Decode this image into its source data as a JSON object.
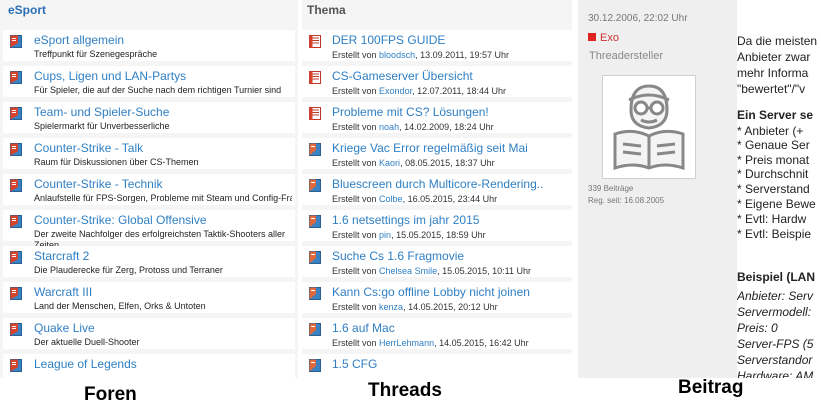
{
  "foren": {
    "header": "eSport",
    "items": [
      {
        "title": "eSport allgemein",
        "desc": "Treffpunkt für Szenegespräche"
      },
      {
        "title": "Cups, Ligen und LAN-Partys",
        "desc": "Für Spieler, die auf der Suche nach dem richtigen Turnier sind"
      },
      {
        "title": "Team- und Spieler-Suche",
        "desc": "Spielermarkt für Unverbesserliche"
      },
      {
        "title": "Counter-Strike - Talk",
        "desc": "Raum für Diskussionen über CS-Themen"
      },
      {
        "title": "Counter-Strike - Technik",
        "desc": "Anlaufstelle für FPS-Sorgen, Probleme mit Steam und Config-Fragen"
      },
      {
        "title": "Counter-Strike: Global Offensive",
        "desc": "Der zweite Nachfolger des erfolgreichsten Taktik-Shooters aller Zeiten"
      },
      {
        "title": "Starcraft 2",
        "desc": "Die Plauderecke für Zerg, Protoss und Terraner"
      },
      {
        "title": "Warcraft III",
        "desc": "Land der Menschen, Elfen, Orks & Untoten"
      },
      {
        "title": "Quake Live",
        "desc": "Der aktuelle Duell-Shooter"
      },
      {
        "title": "League of Legends",
        "desc": ""
      }
    ]
  },
  "threads": {
    "header": "Thema",
    "created_by": "Erstellt von",
    "items": [
      {
        "title": "DER 100FPS GUIDE",
        "user": "bloodsch",
        "date": "13.09.2011, 19:57 Uhr",
        "type": "pinned"
      },
      {
        "title": "CS-Gameserver Übersicht",
        "user": "Exondor",
        "date": "12.07.2011, 18:44 Uhr",
        "type": "pinned"
      },
      {
        "title": "Probleme mit CS? Lösungen!",
        "user": "noah",
        "date": "14.02.2009, 18:24 Uhr",
        "type": "pinned"
      },
      {
        "title": "Kriege Vac Error regelmäßig seit Mai",
        "user": "Kaori",
        "date": "08.05.2015, 18:37 Uhr",
        "type": "normal"
      },
      {
        "title": "Bluescreen durch Multicore-Rendering..",
        "user": "Colbe",
        "date": "16.05.2015, 23:44 Uhr",
        "type": "normal"
      },
      {
        "title": "1.6 netsettings im jahr 2015",
        "user": "pin",
        "date": "15.05.2015, 18:59 Uhr",
        "type": "normal"
      },
      {
        "title": "Suche Cs 1.6 Fragmovie",
        "user": "Chelsea Smile",
        "date": "15.05.2015, 10:11 Uhr",
        "type": "normal"
      },
      {
        "title": "Kann Cs:go offline Lobby nicht joinen",
        "user": "kenza",
        "date": "14.05.2015, 20:12 Uhr",
        "type": "normal"
      },
      {
        "title": "1.6 auf Mac",
        "user": "HerrLehmann",
        "date": "14.05.2015, 16:42 Uhr",
        "type": "normal"
      },
      {
        "title": "1.5 CFG",
        "user": "",
        "date": "",
        "type": "normal"
      }
    ]
  },
  "beitrag": {
    "date": "30.12.2006, 22:02 Uhr",
    "author": "Exo",
    "role": "Threadersteller",
    "posts": "339 Beiträge",
    "registered": "Reg. seit: 16.08.2005",
    "body": [
      {
        "text": "Da die meisten",
        "style": ""
      },
      {
        "text": "Anbieter zwar",
        "style": ""
      },
      {
        "text": "mehr Informa",
        "style": ""
      },
      {
        "text": "\"bewertet\"/\"v",
        "style": ""
      },
      {
        "text": "Ein Server se",
        "style": "b"
      },
      {
        "text": "* Anbieter (+",
        "style": ""
      },
      {
        "text": "* Genaue Ser",
        "style": ""
      },
      {
        "text": "* Preis monat",
        "style": ""
      },
      {
        "text": "* Durchschnit",
        "style": ""
      },
      {
        "text": "* Serverstand",
        "style": ""
      },
      {
        "text": "* Eigene Bewe",
        "style": ""
      },
      {
        "text": "* Evtl: Hardw",
        "style": ""
      },
      {
        "text": "* Evtl: Beispie",
        "style": ""
      },
      {
        "text": "Beispiel (LAN",
        "style": "b"
      },
      {
        "text": "Anbieter: Serv",
        "style": "i"
      },
      {
        "text": "Servermodell:",
        "style": "i"
      },
      {
        "text": "Preis: 0",
        "style": "i"
      },
      {
        "text": "Server-FPS (5",
        "style": "i"
      },
      {
        "text": "Serverstandor",
        "style": "i"
      },
      {
        "text": "Hardware: AM",
        "style": "i"
      }
    ]
  },
  "captions": {
    "foren": "Foren",
    "threads": "Threads",
    "beitrag": "Beitrag"
  },
  "colors": {
    "link": "#2f7fc4",
    "forum_icon_red": "#d9432b",
    "forum_icon_blue": "#3b82c4",
    "author": "#cc3333"
  },
  "icons": {
    "forum": "forum-icon",
    "thread_pinned": "pinned-thread-icon",
    "thread": "thread-icon",
    "avatar": "reading-person-avatar"
  }
}
